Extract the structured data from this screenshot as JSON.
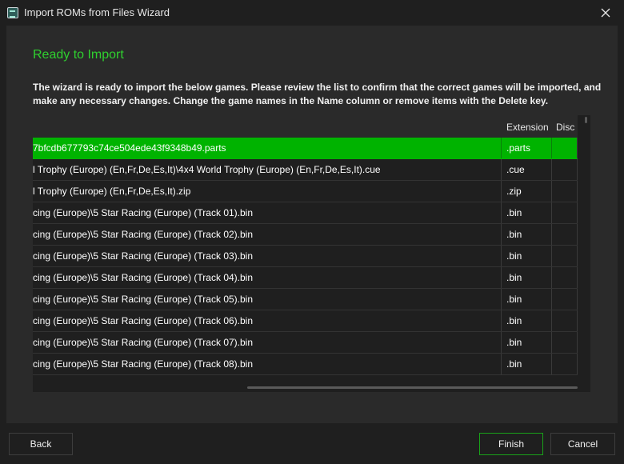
{
  "window": {
    "title": "Import ROMs from Files Wizard"
  },
  "page": {
    "heading": "Ready to Import",
    "description": "The wizard is ready to import the below games. Please review the list to confirm that the correct games will be imported, and make any necessary changes. Change the game names in the Name column or remove items with the Delete key."
  },
  "table": {
    "columns": {
      "extension": "Extension",
      "disc": "Disc"
    },
    "rows": [
      {
        "name": "7bfcdb677793c74ce504ede43f9348b49.parts",
        "extension": ".parts",
        "disc": "",
        "selected": true
      },
      {
        "name": "l Trophy (Europe) (En,Fr,De,Es,It)\\4x4 World Trophy (Europe) (En,Fr,De,Es,It).cue",
        "extension": ".cue",
        "disc": ""
      },
      {
        "name": "l Trophy (Europe) (En,Fr,De,Es,It).zip",
        "extension": ".zip",
        "disc": ""
      },
      {
        "name": "cing (Europe)\\5 Star Racing (Europe) (Track 01).bin",
        "extension": ".bin",
        "disc": ""
      },
      {
        "name": "cing (Europe)\\5 Star Racing (Europe) (Track 02).bin",
        "extension": ".bin",
        "disc": ""
      },
      {
        "name": "cing (Europe)\\5 Star Racing (Europe) (Track 03).bin",
        "extension": ".bin",
        "disc": ""
      },
      {
        "name": "cing (Europe)\\5 Star Racing (Europe) (Track 04).bin",
        "extension": ".bin",
        "disc": ""
      },
      {
        "name": "cing (Europe)\\5 Star Racing (Europe) (Track 05).bin",
        "extension": ".bin",
        "disc": ""
      },
      {
        "name": "cing (Europe)\\5 Star Racing (Europe) (Track 06).bin",
        "extension": ".bin",
        "disc": ""
      },
      {
        "name": "cing (Europe)\\5 Star Racing (Europe) (Track 07).bin",
        "extension": ".bin",
        "disc": ""
      },
      {
        "name": "cing (Europe)\\5 Star Racing (Europe) (Track 08).bin",
        "extension": ".bin",
        "disc": ""
      }
    ]
  },
  "buttons": {
    "back": "Back",
    "finish": "Finish",
    "cancel": "Cancel"
  },
  "colors": {
    "accent": "#2fd02f",
    "selection": "#00b300",
    "background": "#1f1f1f",
    "panel": "#2a2a2a"
  },
  "icons": {
    "app": "rom-import-icon",
    "close": "close-icon"
  }
}
